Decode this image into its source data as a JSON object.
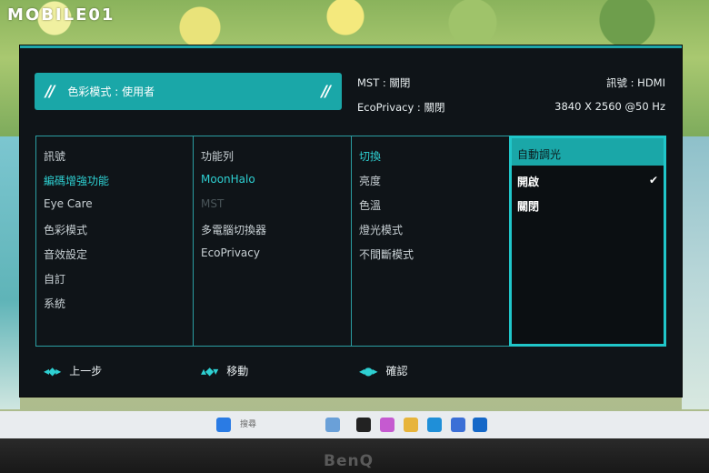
{
  "watermark": "MOBILE01",
  "header": {
    "mode_banner": "色彩模式 : 使用者",
    "mst": "MST : 關閉",
    "ecoprivacy": "EcoPrivacy : 關閉",
    "signal": "訊號 : HDMI",
    "resolution": "3840 X 2560 @50 Hz"
  },
  "menu": {
    "column1": [
      "訊號",
      "編碼增強功能",
      "Eye Care",
      "色彩模式",
      "音效設定",
      "自訂",
      "系統"
    ],
    "column2": [
      "功能列",
      "MoonHalo",
      "MST",
      "多電腦切換器",
      "EcoPrivacy"
    ],
    "column3": [
      "切換",
      "亮度",
      "色溫",
      "燈光模式",
      "不間斷模式"
    ],
    "column4": {
      "title": "自動調光",
      "options": [
        "開啟",
        "關閉"
      ],
      "checkmark": "✔"
    }
  },
  "footer": {
    "back": "上一步",
    "move": "移動",
    "confirm": "確認"
  },
  "taskbar": {
    "search_placeholder": "搜尋"
  },
  "brand": "BenQ",
  "colors": {
    "accent": "#1aa7a8",
    "panel": "#0f1418",
    "highlight_text": "#2ed0d2"
  }
}
